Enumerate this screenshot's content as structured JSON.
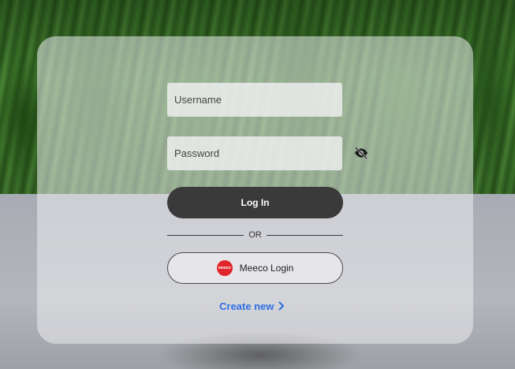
{
  "login_form": {
    "username": {
      "value": "",
      "placeholder": "Username"
    },
    "password": {
      "value": "",
      "placeholder": "Password"
    },
    "login_label": "Log In",
    "divider_label": "OR",
    "meeco_label": "Meeco Login",
    "meeco_logo_text": "meeco",
    "create_new_label": "Create new"
  },
  "icons": {
    "password_toggle": "eye-off-icon",
    "create_new_chevron": "chevron-right-icon",
    "meeco_logo": "meeco-logo-icon"
  },
  "colors": {
    "login_button_bg": "#3a3a3b",
    "link_blue": "#2f6fe4",
    "meeco_red": "#e0262a"
  }
}
